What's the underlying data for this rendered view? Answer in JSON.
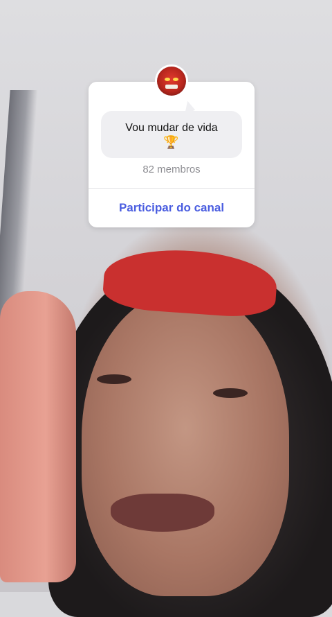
{
  "channel_card": {
    "channel_name": "Vou mudar de vida",
    "channel_emoji": "🏆",
    "member_count": "82 membros",
    "join_label": "Participar do canal",
    "accent_color": "#4a5de0"
  },
  "background": {
    "icon": "video-background-person"
  }
}
